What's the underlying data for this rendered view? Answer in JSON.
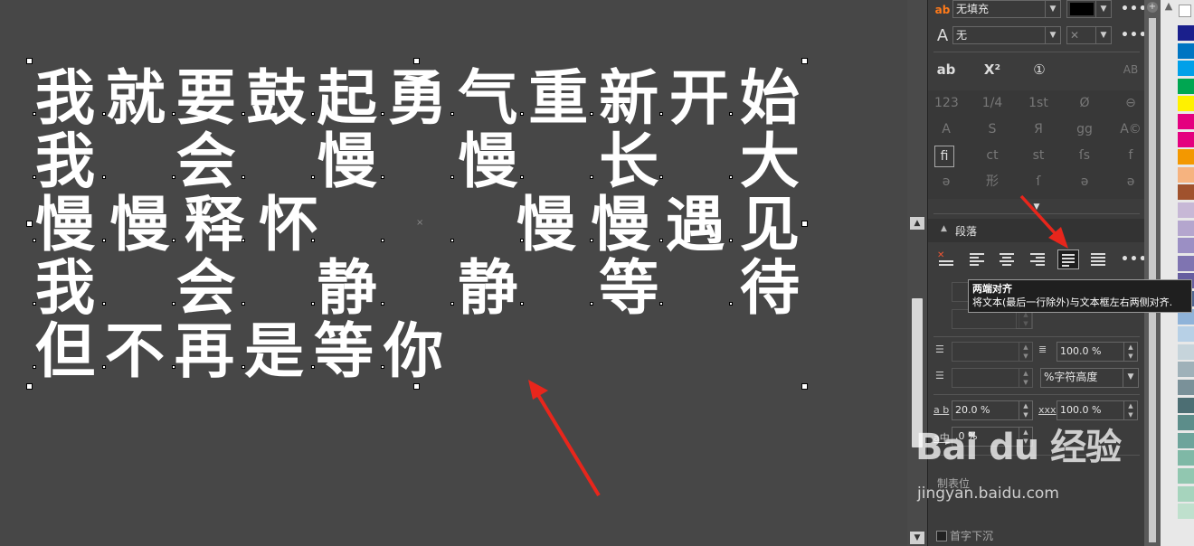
{
  "canvas": {
    "text_lines": [
      {
        "chars": [
          "我",
          "就",
          "要",
          "鼓",
          "起",
          "勇",
          "气",
          "重",
          "新",
          "开",
          "始"
        ],
        "justify": "full"
      },
      {
        "chars": [
          "我",
          "会",
          "慢",
          "慢",
          "长",
          "大"
        ],
        "justify": "full"
      },
      {
        "chars": [
          "慢",
          "慢",
          "释",
          "怀",
          "慢",
          "慢",
          "遇",
          "见"
        ],
        "justify": "gap"
      },
      {
        "chars": [
          "我",
          "会",
          "静",
          "静",
          "等",
          "待"
        ],
        "justify": "full"
      },
      {
        "chars": [
          "但",
          "不",
          "再",
          "是",
          "等",
          "你"
        ],
        "justify": "left"
      }
    ]
  },
  "panel": {
    "fill_select": "无填充",
    "outline_select": "无",
    "typo_icons": [
      "ab",
      "X²",
      "①",
      "AB"
    ],
    "glyph_grid": [
      [
        "123",
        "1/4",
        "1st",
        "Ø",
        "⊖"
      ],
      [
        "A",
        "S",
        "Я",
        "gg",
        "A©"
      ],
      [
        "fi",
        "ct",
        "st",
        "ſs",
        "f"
      ],
      [
        "ə",
        "形",
        "ſ",
        "ə",
        "ə"
      ]
    ],
    "section_paragraph": "段落",
    "tooltip": {
      "title": "两端对齐",
      "description": "将文本(最后一行除外)与文本框左右两侧对齐."
    },
    "line_spacing": "100.0 %",
    "spacing_unit": "%字符高度",
    "char_spacing": "20.0 %",
    "word_spacing": "100.0 %",
    "lang_spacing": ".0 %",
    "bottom_label_1": "制表位",
    "bottom_label_2": "首字下沉",
    "more": "•••"
  },
  "palette": {
    "colors": [
      "#1a1f8c",
      "#0075c2",
      "#00a0e9",
      "#00a651",
      "#fff100",
      "#e4007f",
      "#e4007f",
      "#f39800",
      "#f6b37f",
      "#a0522d",
      "#c7b8d6",
      "#b4a6ce",
      "#9b8fc4",
      "#7f74b1",
      "#665ea0",
      "#4d6591",
      "#8fb3d9",
      "#b7d0e6",
      "#c6d4db",
      "#9fb1b9",
      "#7a9199",
      "#4c6e73",
      "#5c8d8a",
      "#6da49b",
      "#7fb8a6",
      "#91c7b0",
      "#a6d4bd",
      "#bfe0cd"
    ]
  },
  "watermark": {
    "logo": "Bai du 经验",
    "url": "jingyan.baidu.com"
  }
}
